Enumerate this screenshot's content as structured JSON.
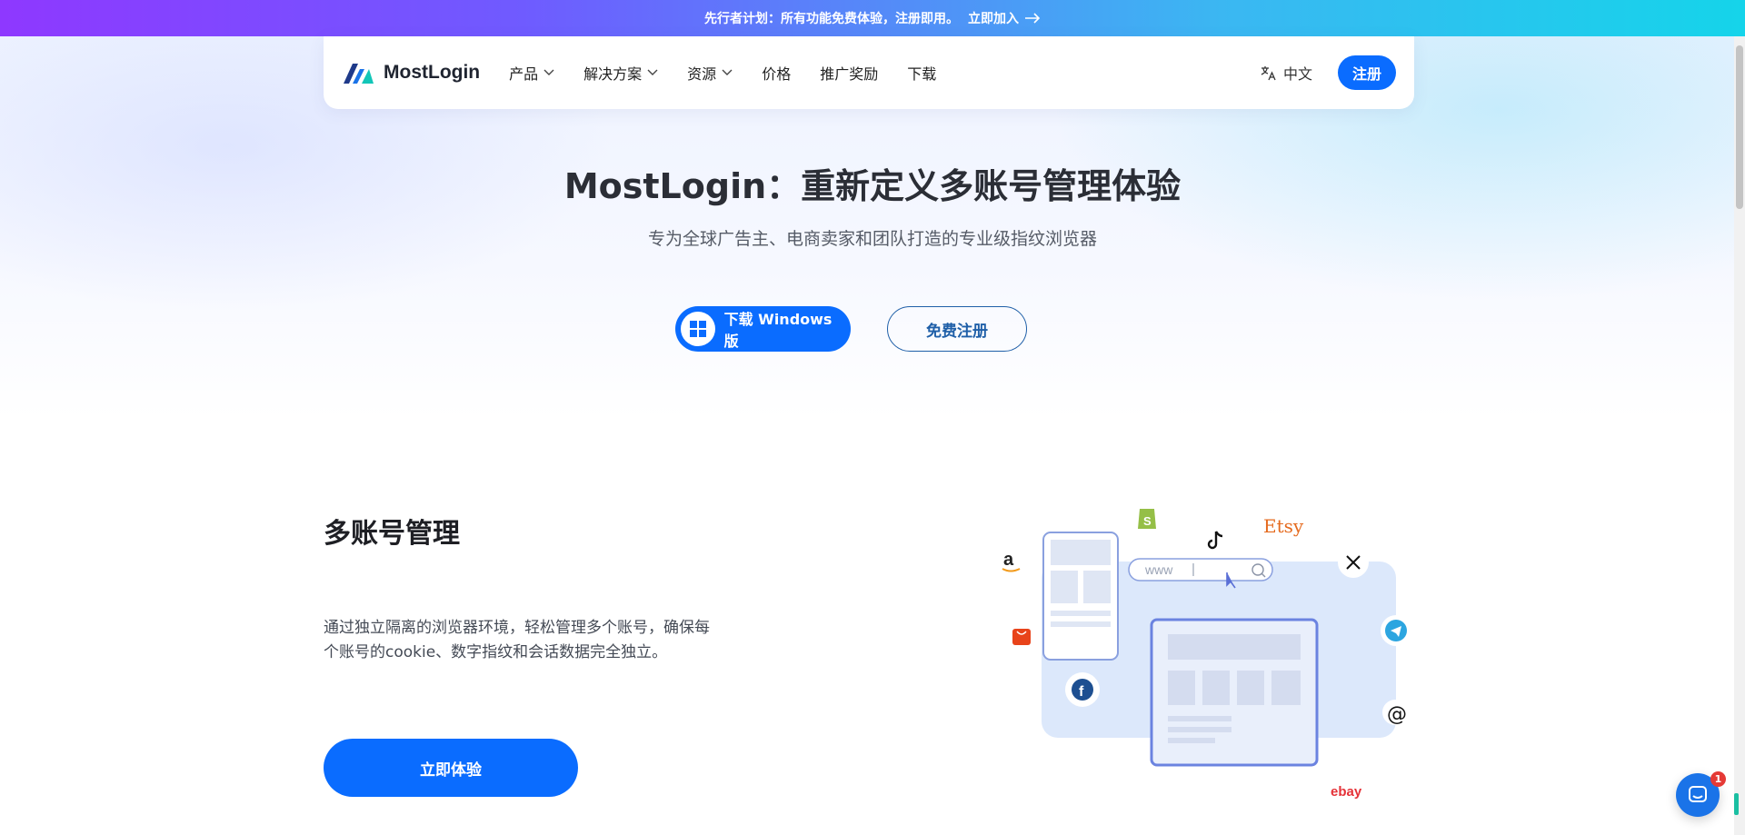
{
  "announcement": {
    "text": "先行者计划：所有功能免费体验，注册即用。",
    "link": "立即加入"
  },
  "nav": {
    "brand": "MostLogin",
    "items": [
      {
        "label": "产品",
        "dropdown": true
      },
      {
        "label": "解决方案",
        "dropdown": true
      },
      {
        "label": "资源",
        "dropdown": true
      },
      {
        "label": "价格",
        "dropdown": false
      },
      {
        "label": "推广奖励",
        "dropdown": false
      },
      {
        "label": "下载",
        "dropdown": false
      }
    ],
    "language": "中文",
    "register": "注册"
  },
  "hero": {
    "title": "MostLogin：重新定义多账号管理体验",
    "subtitle": "专为全球广告主、电商卖家和团队打造的专业级指纹浏览器",
    "download_btn": "下载 Windows版",
    "free_btn": "免费注册"
  },
  "feature": {
    "title": "多账号管理",
    "description": "通过独立隔离的浏览器环境，轻松管理多个账号，确保每个账号的cookie、数字指纹和会话数据完全独立。",
    "cta": "立即体验"
  },
  "illustration": {
    "url_placeholder": "www",
    "brands": {
      "etsy": "Etsy",
      "ebay": "ebay",
      "amazon": "a"
    }
  },
  "chat": {
    "badge": "1"
  },
  "colors": {
    "primary": "#0a6cff",
    "outline": "#1f5fa8",
    "banner_start": "#8e38ff",
    "banner_end": "#15d4ea"
  }
}
